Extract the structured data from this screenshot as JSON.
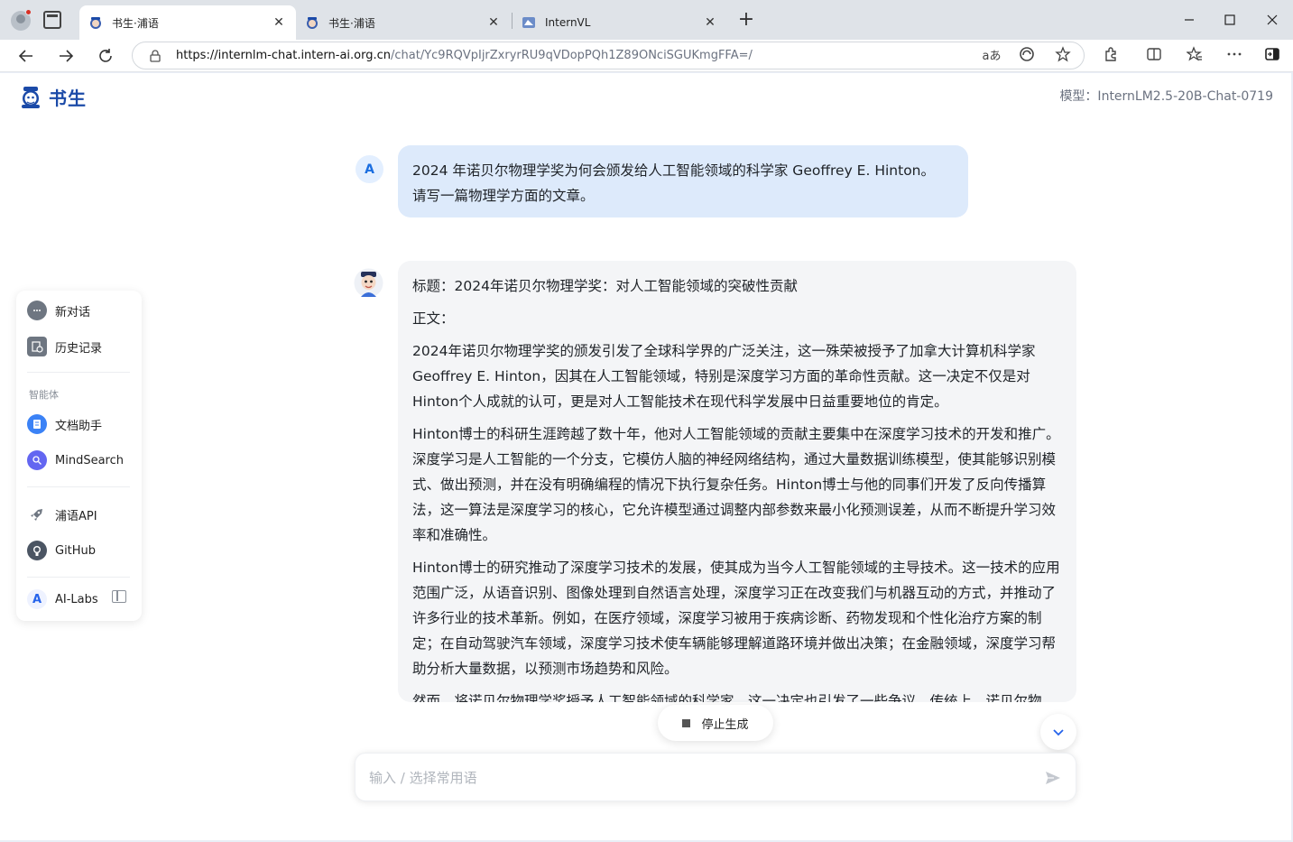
{
  "browser": {
    "tabs": [
      {
        "label": "书生·浦语",
        "close": "✕",
        "active": true
      },
      {
        "label": "书生·浦语",
        "close": "✕",
        "active": false
      },
      {
        "label": "InternVL",
        "close": "✕",
        "active": false
      }
    ],
    "new_tab": "+",
    "url_host": "https://internlm-chat.intern-ai.org.cn",
    "url_path": "/chat/Yc9RQVpIjrZxryrRU9qVDopPQh1Z89ONciSGUKmgFFA=/",
    "read_aloud_label": "aあ"
  },
  "header": {
    "logo_text": "书生",
    "model_label": "模型：InternLM2.5-20B-Chat-0719"
  },
  "sidebar": {
    "new_chat": "新对话",
    "history": "历史记录",
    "agents_caption": "智能体",
    "doc_assistant": "文档助手",
    "mindsearch": "MindSearch",
    "api": "浦语API",
    "github": "GitHub",
    "ailabs": "AI-Labs",
    "ailabs_icon_letter": "A"
  },
  "chat": {
    "user_avatar_letter": "A",
    "user_message_line1": "2024 年诺贝尔物理学奖为何会颁发给人工智能领域的科学家 Geoffrey E. Hinton。",
    "user_message_line2": "请写一篇物理学方面的文章。",
    "bot_paragraphs": [
      "标题：2024年诺贝尔物理学奖：对人工智能领域的突破性贡献",
      "正文：",
      "2024年诺贝尔物理学奖的颁发引发了全球科学界的广泛关注，这一殊荣被授予了加拿大计算机科学家Geoffrey E. Hinton，因其在人工智能领域，特别是深度学习方面的革命性贡献。这一决定不仅是对Hinton个人成就的认可，更是对人工智能技术在现代科学发展中日益重要地位的肯定。",
      "Hinton博士的科研生涯跨越了数十年，他对人工智能领域的贡献主要集中在深度学习技术的开发和推广。深度学习是人工智能的一个分支，它模仿人脑的神经网络结构，通过大量数据训练模型，使其能够识别模式、做出预测，并在没有明确编程的情况下执行复杂任务。Hinton博士与他的同事们开发了反向传播算法，这一算法是深度学习的核心，它允许模型通过调整内部参数来最小化预测误差，从而不断提升学习效率和准确性。",
      "Hinton博士的研究推动了深度学习技术的发展，使其成为当今人工智能领域的主导技术。这一技术的应用范围广泛，从语音识别、图像处理到自然语言处理，深度学习正在改变我们与机器互动的方式，并推动了许多行业的技术革新。例如，在医疗领域，深度学习被用于疾病诊断、药物发现和个性化治疗方案的制定；在自动驾驶汽车领域，深度学习技术使车辆能够理解道路环境并做出决策；在金融领域，深度学习帮助分析大量数据，以预测市场趋势和风险。",
      "然而，将诺贝尔物理学奖授予人工智能领域的科学家，这一决定也引发了一些争议。传统上，诺贝尔物"
    ],
    "stop_label": "停止生成",
    "input_placeholder": "输入 / 选择常用语",
    "input_value": ""
  },
  "colors": {
    "brand": "#1b4aa8",
    "user_bubble": "#ddeafb",
    "bot_bubble": "#f4f5f7"
  }
}
